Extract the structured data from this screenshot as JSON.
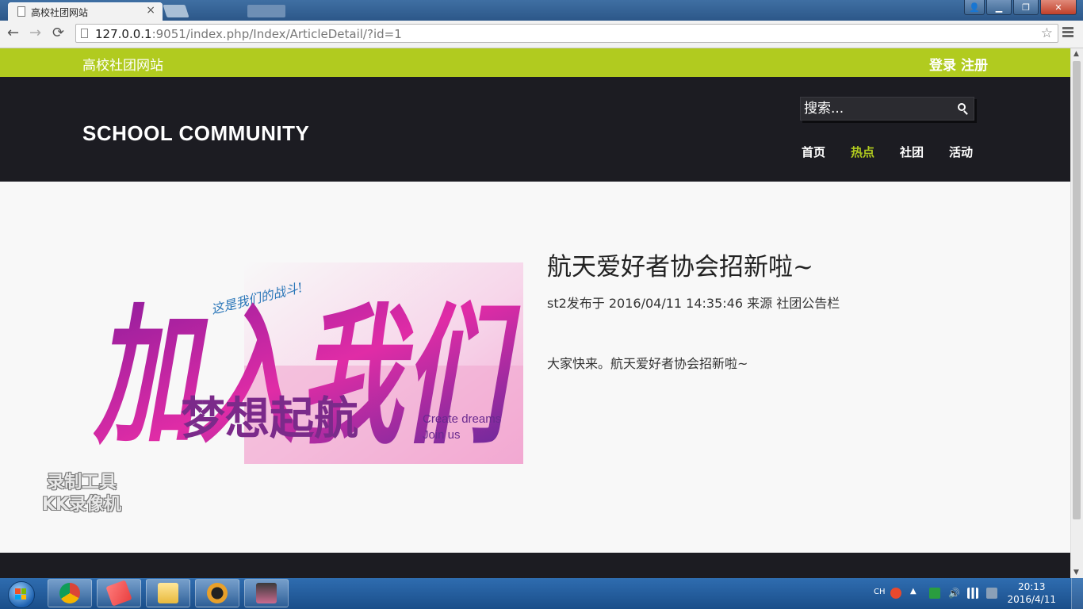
{
  "browser": {
    "tab_title": "高校社团网站",
    "tab_close": "×",
    "url_host": "127.0.0.1",
    "url_rest": ":9051/index.php/Index/ArticleDetail/?id=1",
    "back": "←",
    "forward": "→",
    "reload": "⟳",
    "star": "☆",
    "window_buttons": {
      "minimize": "▁",
      "maximize": "❐",
      "close": "✕",
      "user": "👤"
    }
  },
  "site": {
    "name": "高校社团网站",
    "login": "登录",
    "register": "注册",
    "brand": "SCHOOL COMMUNITY",
    "search_placeholder": "搜索...",
    "nav": [
      {
        "label": "首页",
        "active": false
      },
      {
        "label": "热点",
        "active": true
      },
      {
        "label": "社团",
        "active": false
      },
      {
        "label": "活动",
        "active": false
      }
    ]
  },
  "article": {
    "title": "航天爱好者协会招新啦~",
    "meta": "st2发布于 2016/04/11 14:35:46 来源 社团公告栏",
    "body": "大家快来。航天爱好者协会招新啦~",
    "image": {
      "big_text": "加入我们",
      "slogan": "这是我们的战斗!",
      "subtitle": "梦想起航",
      "english_1": "Create dreams",
      "english_2": "Join us"
    }
  },
  "watermark": {
    "line1": "录制工具",
    "line2": "KK录像机"
  },
  "taskbar": {
    "lang": "CH",
    "time": "20:13",
    "date": "2016/4/11",
    "up_arrow": "▲"
  },
  "colors": {
    "accent": "#b1cb1f",
    "header_bg": "#1c1c22",
    "page_bg": "#f8f8f8"
  }
}
